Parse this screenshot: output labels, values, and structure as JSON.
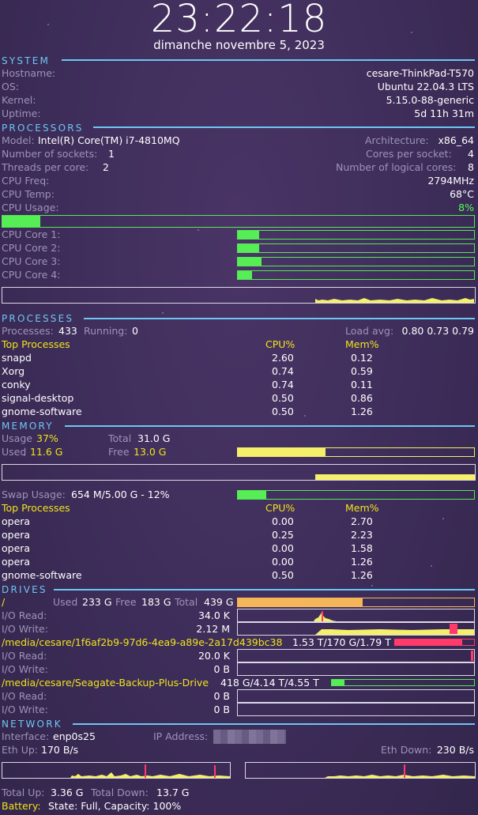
{
  "clock": {
    "time": "23:22:18",
    "date": "dimanche novembre  5, 2023"
  },
  "system": {
    "header": "SYSTEM",
    "hostname_label": "Hostname:",
    "hostname": "cesare-ThinkPad-T570",
    "os_label": "OS:",
    "os": "Ubuntu 22.04.3 LTS",
    "kernel_label": "Kernel:",
    "kernel": "5.15.0-88-generic",
    "uptime_label": "Uptime:",
    "uptime": "5d 11h 31m"
  },
  "processors": {
    "header": "PROCESSORS",
    "model_label": "Model:",
    "model": "Intel(R) Core(TM) i7-4810MQ",
    "arch_label": "Architecture:",
    "arch": "x86_64",
    "sockets_label": "Number of sockets:",
    "sockets": "1",
    "cores_label": "Cores per socket:",
    "cores": "4",
    "threads_label": "Threads per core:",
    "threads": "2",
    "logical_label": "Number of logical cores:",
    "logical": "8",
    "freq_label": "CPU Freq:",
    "freq": "2794MHz",
    "temp_label": "CPU Temp:",
    "temp": "68°C",
    "usage_label": "CPU Usage:",
    "usage": "8%",
    "usage_fraction": 0.08,
    "cores_list": [
      {
        "label": "CPU Core 1:",
        "fraction": 0.09
      },
      {
        "label": "CPU Core 2:",
        "fraction": 0.09
      },
      {
        "label": "CPU Core 3:",
        "fraction": 0.1
      },
      {
        "label": "CPU Core 4:",
        "fraction": 0.06
      }
    ]
  },
  "processes": {
    "header": "PROCESSES",
    "count_label": "Processes:",
    "count": "433",
    "running_label": "Running:",
    "running": "0",
    "load_label": "Load avg:",
    "load": "0.80 0.73 0.79",
    "top_label": "Top Processes",
    "cpu_label": "CPU%",
    "mem_label": "Mem%",
    "rows": [
      {
        "name": "snapd",
        "cpu": "2.60",
        "mem": "0.12"
      },
      {
        "name": "Xorg",
        "cpu": "0.74",
        "mem": "0.59"
      },
      {
        "name": "conky",
        "cpu": "0.74",
        "mem": "0.11"
      },
      {
        "name": "signal-desktop",
        "cpu": "0.50",
        "mem": "0.86"
      },
      {
        "name": "gnome-software",
        "cpu": "0.50",
        "mem": "1.26"
      }
    ]
  },
  "memory": {
    "header": "MEMORY",
    "usage_label": "Usage",
    "usage": "37%",
    "total_label": "Total",
    "total": "31.0 G",
    "used_label": "Used",
    "used": "11.6 G",
    "free_label": "Free",
    "free": "13.0 G",
    "used_fraction": 0.37,
    "swap_label": "Swap Usage:",
    "swap": "654 M/5.00 G - 12%",
    "swap_fraction": 0.12,
    "top_label": "Top Processes",
    "cpu_label": "CPU%",
    "mem_label": "Mem%",
    "rows": [
      {
        "name": "opera",
        "cpu": "0.00",
        "mem": "2.70"
      },
      {
        "name": "opera",
        "cpu": "0.25",
        "mem": "2.23"
      },
      {
        "name": "opera",
        "cpu": "0.00",
        "mem": "1.58"
      },
      {
        "name": "opera",
        "cpu": "0.00",
        "mem": "1.26"
      },
      {
        "name": "gnome-software",
        "cpu": "0.50",
        "mem": "1.26"
      }
    ]
  },
  "drives": {
    "header": "DRIVES",
    "root": {
      "mount": "/",
      "used_label": "Used",
      "used": "233 G",
      "free_label": "Free",
      "free": "183 G",
      "total_label": "Total",
      "total": "439 G",
      "fraction": 0.53,
      "read_label": "I/O Read:",
      "read": "34.0 K",
      "write_label": "I/O Write:",
      "write": "2.12 M"
    },
    "media1": {
      "mount": "/media/cesare/1f6af2b9-97d6-4ea9-a89e-2a17d439bc38",
      "summary": "1.53 T/170 G/1.79 T",
      "fraction": 0.85,
      "read_label": "I/O Read:",
      "read": "20.0 K",
      "write_label": "I/O Write:",
      "write": "0 B"
    },
    "media2": {
      "mount": "/media/cesare/Seagate-Backup-Plus-Drive",
      "summary": "418 G/4.14 T/4.55 T",
      "fraction": 0.09,
      "read_label": "I/O Read:",
      "read": "0 B",
      "write_label": "I/O Write:",
      "write": "0 B"
    }
  },
  "network": {
    "header": "NETWORK",
    "iface_label": "Interface:",
    "iface": "enp0s25",
    "ip_label": "IP Address:",
    "up_label": "Eth Up:",
    "up": "170 B/s",
    "down_label": "Eth Down:",
    "down": "230 B/s",
    "total_up_label": "Total Up:",
    "total_up": "3.36 G",
    "total_down_label": "Total Down:",
    "total_down": "13.7 G"
  },
  "battery": {
    "label": "Battery:",
    "value": "State: Full, Capacity: 100%"
  },
  "colors": {
    "accent": "#6ec6f2",
    "green": "#55ee55",
    "yellow": "#f0e31a",
    "red": "#ff3b6b",
    "orange": "#f5b65a"
  }
}
